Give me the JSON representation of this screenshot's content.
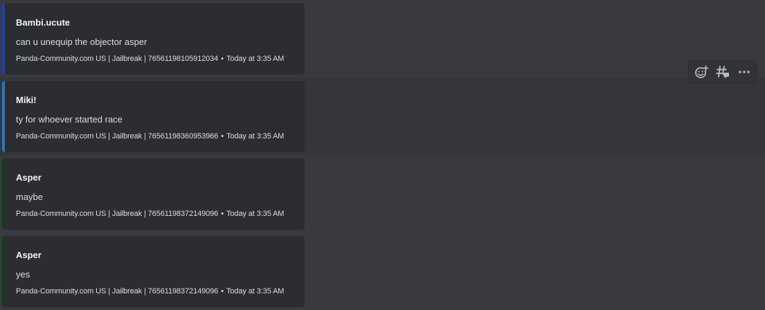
{
  "colors": {
    "background": "#383a40",
    "embed_background": "#2b2d31",
    "accent_blue_dark": "#1e3fbf",
    "accent_blue": "#1f78d1",
    "accent_green_dark": "#0f3d1a"
  },
  "messages": [
    {
      "title": "Bambi.ucute",
      "description": "can u unequip the objector asper",
      "footer_text": "Panda-Community.com US | Jailbreak | 76561198105912034",
      "footer_time": "Today at 3:35 AM",
      "accent": "#1e3fbf"
    },
    {
      "title": "Miki!",
      "description": "ty for whoever started race",
      "footer_text": "Panda-Community.com US | Jailbreak | 76561198360953966",
      "footer_time": "Today at 3:35 AM",
      "accent": "#1f78d1"
    },
    {
      "title": "Asper",
      "description": "maybe",
      "footer_text": "Panda-Community.com US | Jailbreak | 76561198372149096",
      "footer_time": "Today at 3:35 AM",
      "accent": "#0f3d1a"
    },
    {
      "title": "Asper",
      "description": "yes",
      "footer_text": "Panda-Community.com US | Jailbreak | 76561198372149096",
      "footer_time": "Today at 3:35 AM",
      "accent": "#0f3d1a"
    }
  ],
  "footer_separator": "•",
  "toolbar": {
    "icons": [
      "add-reaction-icon",
      "create-thread-icon",
      "more-icon"
    ]
  }
}
